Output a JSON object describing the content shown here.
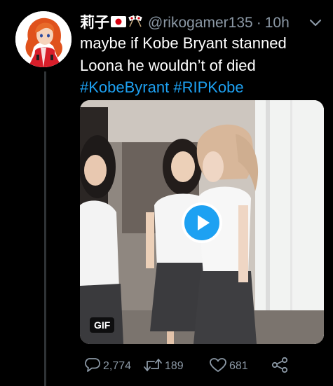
{
  "tweet": {
    "display_name": "莉子",
    "handle": "@rikogamer135",
    "separator": "·",
    "time": "10h",
    "text_line1": "maybe if Kobe Bryant stanned",
    "text_line2": "Loona he wouldn’t of died",
    "hashtags": [
      "#KobeByrant",
      "#RIPKobe"
    ],
    "media": {
      "badge": "GIF"
    },
    "actions": {
      "reply_count": "2,774",
      "retweet_count": "189",
      "like_count": "681"
    }
  },
  "colors": {
    "background": "#000000",
    "text": "#ffffff",
    "secondary": "#8b98a5",
    "accent": "#1da1f2",
    "thread_line": "#2f3336"
  },
  "icons": [
    "japan-flag-icon",
    "crossed-flags-icon",
    "chevron-down-icon",
    "reply-icon",
    "retweet-icon",
    "like-icon",
    "share-icon",
    "play-icon"
  ]
}
